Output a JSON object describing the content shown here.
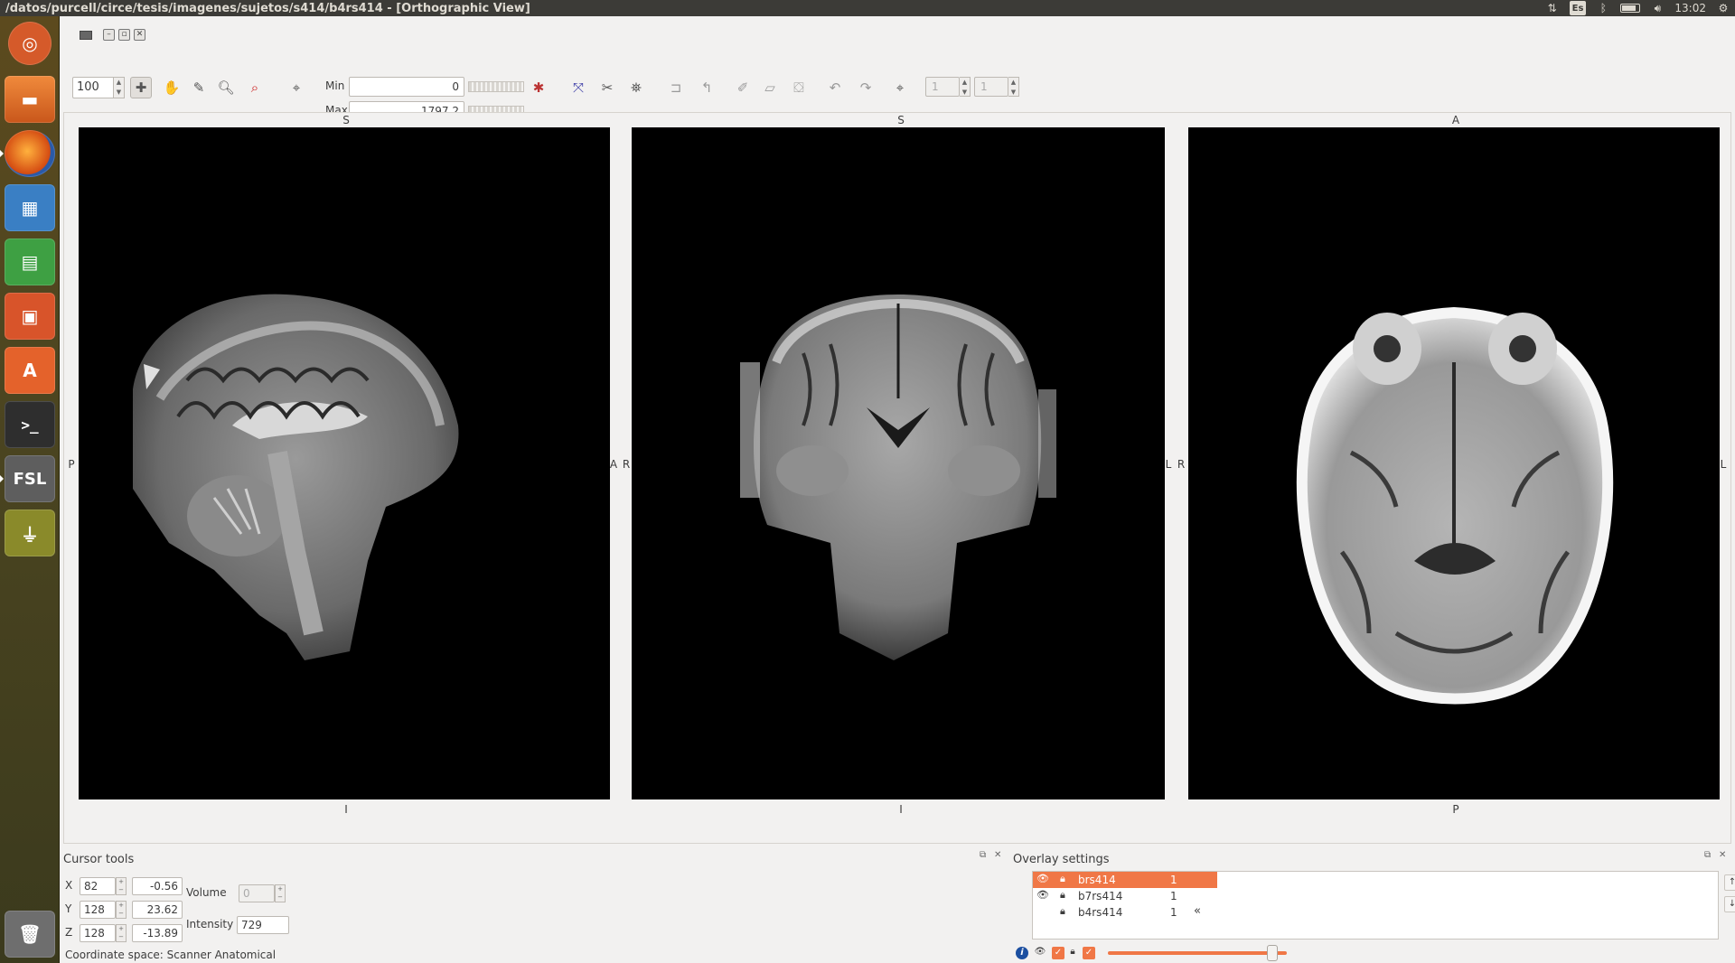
{
  "top_panel": {
    "title": "/datos/purcell/circe/tesis/imagenes/sujetos/s414/b4rs414 - [Orthographic View]",
    "keyboard_layout": "Es",
    "clock": "13:02"
  },
  "launcher": {
    "items": [
      {
        "name": "Ubuntu",
        "color": "#d55a2a"
      },
      {
        "name": "Files",
        "color": "#e56f2c"
      },
      {
        "name": "Firefox",
        "color": "#e8621c"
      },
      {
        "name": "LibreOffice Draw",
        "color": "#3a7fc4"
      },
      {
        "name": "LibreOffice Calc",
        "color": "#3ea043"
      },
      {
        "name": "LibreOffice Impress",
        "color": "#d8542a"
      },
      {
        "name": "Ubuntu Software Center",
        "color": "#e4622b"
      },
      {
        "name": "Terminal",
        "color": "#3a3a3a"
      },
      {
        "name": "FSL",
        "color": "#6a6a6a"
      },
      {
        "name": "USB",
        "color": "#8a8a2a"
      },
      {
        "name": "Trash",
        "color": "#777777"
      }
    ]
  },
  "toolbar": {
    "zoom": "100",
    "min_label": "Min",
    "max_label": "Max",
    "min_value": "0",
    "max_value": "1797.2",
    "frame_value_1": "1",
    "frame_value_2": "1"
  },
  "views": {
    "sagittal": {
      "top": "S",
      "bottom": "I",
      "left": "P",
      "right": "A"
    },
    "coronal": {
      "top": "S",
      "bottom": "I",
      "left": "R",
      "right": "L"
    },
    "axial": {
      "top": "A",
      "bottom": "P",
      "left": "R",
      "right": "L"
    }
  },
  "cursor_tools": {
    "title": "Cursor tools",
    "x_label": "X",
    "y_label": "Y",
    "z_label": "Z",
    "x_voxel": "82",
    "y_voxel": "128",
    "z_voxel": "128",
    "x_world": "-0.56",
    "y_world": "23.62",
    "z_world": "-13.89",
    "volume_label": "Volume",
    "volume_value": "0",
    "intensity_label": "Intensity",
    "intensity_value": "729",
    "coordinate_space": "Coordinate space: Scanner Anatomical"
  },
  "overlay_settings": {
    "title": "Overlay settings",
    "layers": [
      {
        "name": "brs414",
        "value": "1",
        "visible": true,
        "selected": true
      },
      {
        "name": "b7rs414",
        "value": "1",
        "visible": true,
        "selected": false
      },
      {
        "name": "b4rs414",
        "value": "1",
        "visible": false,
        "selected": false
      }
    ],
    "opacity": 0.92,
    "accent_color": "#f07746"
  }
}
